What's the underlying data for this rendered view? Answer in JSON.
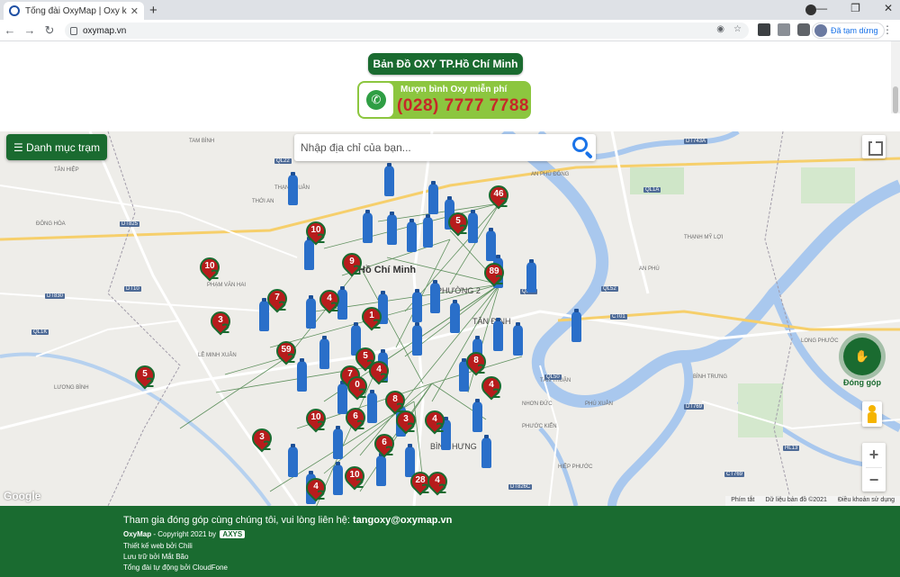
{
  "browser": {
    "tab_title": "Tổng đài OxyMap | Oxy khẩn cấp",
    "url": "oxymap.vn",
    "profile_status": "Đã tạm dừng"
  },
  "header": {
    "title": "Bản Đồ OXY TP.Hồ Chí Minh",
    "hotline_label": "Mượn bình Oxy miễn phí",
    "hotline_number": "(028) 7777 7788"
  },
  "map": {
    "menu_button": "☰ Danh mục trạm",
    "search_placeholder": "Nhập địa chỉ của bạn...",
    "donate_label": "Đóng góp",
    "zoom_in": "+",
    "zoom_out": "−",
    "google": "Google",
    "attribution": [
      "Phím tắt",
      "Dữ liệu bản đồ ©2021",
      "Điều khoản sử dụng"
    ],
    "city_name": "Hồ Chí Minh",
    "districts": [
      "PHƯỜNG 2",
      "TÂN ĐỊNH",
      "BÌNH HƯNG"
    ],
    "place_labels": [
      "TAM BÌNH",
      "ĐÔNG HÒA",
      "TÂN HIỆP",
      "AN PHÚ ĐÔNG",
      "THẠNH XUÂN",
      "THỚI AN",
      "AN PHÚ",
      "THẠNH MỸ LỢI",
      "PHÚ XUÂN",
      "NHƠN ĐỨC",
      "TÂN THUẬN",
      "PHƯỚC KIỂN",
      "BÌNH TRƯNG",
      "LONG PHƯỚC",
      "PHẠM VĂN HAI",
      "LÊ MINH XUÂN",
      "LƯƠNG BÌNH",
      "HIỆP PHƯỚC"
    ],
    "roads": [
      "QL1A",
      "QL22",
      "DT825",
      "DT830",
      "QL50",
      "QL52",
      "CT01",
      "DT743A",
      "QL13",
      "DT769",
      "HL13",
      "DT10",
      "QL1K",
      "DT826C",
      "CT769"
    ],
    "markers": [
      "10",
      "46",
      "5",
      "9",
      "89",
      "10",
      "3",
      "7",
      "4",
      "1",
      "59",
      "5",
      "7",
      "5",
      "0",
      "4",
      "6",
      "8",
      "10",
      "3",
      "4",
      "10",
      "4",
      "6",
      "3",
      "28",
      "4",
      "8",
      "4"
    ],
    "marker_suffix": "2"
  },
  "footer": {
    "invite_text": "Tham gia đóng góp cùng chúng tôi, vui lòng liên hệ:",
    "email": "tangoxy@oxymap.vn",
    "brand": "OxyMap",
    "copyright": "- Copyright 2021 by",
    "axys": "AXYS",
    "credit_web": "Thiết kế web bởi Chili",
    "credit_host": "Lưu trữ bởi Mắt Bão",
    "credit_call": "Tổng đài tự động bởi CloudFone"
  },
  "colors": {
    "brand_green": "#1a6b30",
    "marker_red": "#b71c1c",
    "tank_blue": "#2a6fc9",
    "hotline_green": "#8cc63f",
    "hotline_red": "#c62828"
  }
}
